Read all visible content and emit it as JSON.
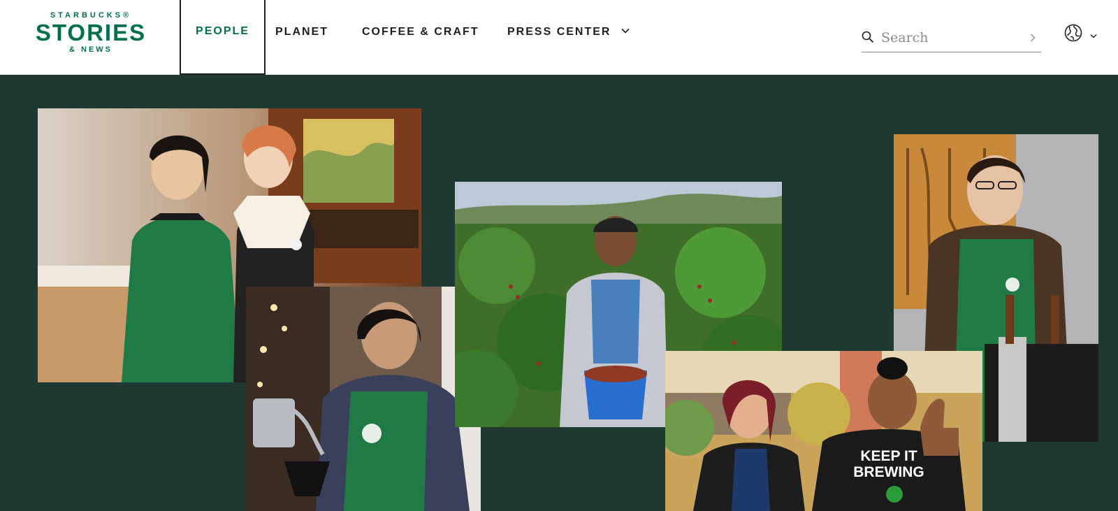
{
  "logo": {
    "line1": "STARBUCKS®",
    "line2": "STORIES",
    "line3": "& NEWS"
  },
  "nav": {
    "items": [
      {
        "label": "PEOPLE"
      },
      {
        "label": "PLANET"
      },
      {
        "label": "COFFEE & CRAFT"
      },
      {
        "label": "PRESS CENTER"
      }
    ]
  },
  "search": {
    "placeholder": "Search"
  },
  "photos": {
    "shirt_text": "KEEP IT\nBREWING",
    "shirt_line1": "KEEP IT",
    "shirt_line2": "BREWING"
  },
  "colors": {
    "brand_green": "#00704a",
    "house_green": "#1e3932",
    "apron_green": "#1f7a46"
  },
  "icons": {
    "search": "search-icon",
    "submit": "chevron-right-icon",
    "language": "globe-icon",
    "dropdown": "chevron-down-icon"
  }
}
